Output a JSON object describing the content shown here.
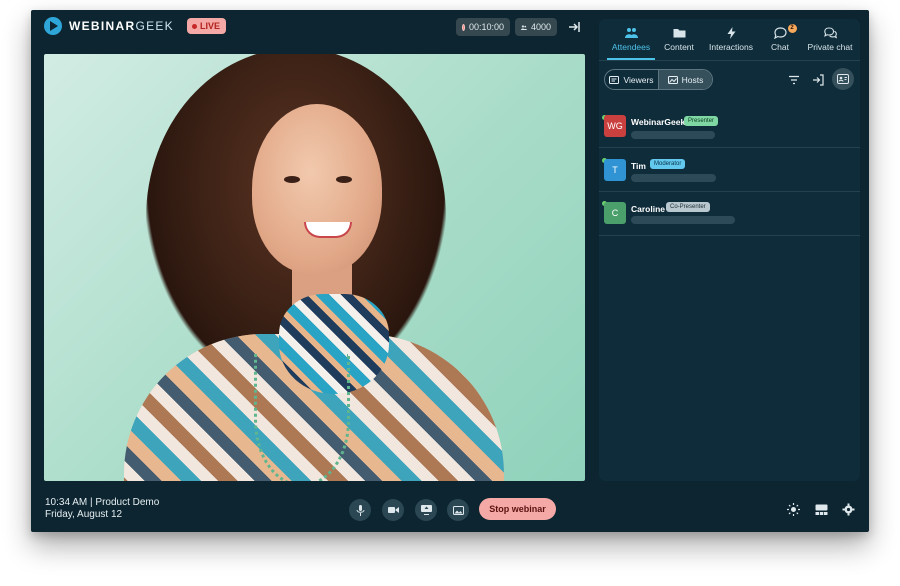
{
  "header": {
    "brand_bold": "WEBINAR",
    "brand_light": "GEEK",
    "live_label": "LIVE",
    "timer": "00:10:00",
    "viewer_count": "4000"
  },
  "footer": {
    "time_and_title": "10:34 AM | Product Demo",
    "date": "Friday, August 12",
    "stop_label": "Stop webinar"
  },
  "panel": {
    "tabs": [
      {
        "label": "Attendees",
        "icon": "attendees-icon",
        "active": true
      },
      {
        "label": "Content",
        "icon": "folder-icon"
      },
      {
        "label": "Interactions",
        "icon": "lightning-icon"
      },
      {
        "label": "Chat",
        "icon": "chat-icon",
        "badge": "2"
      },
      {
        "label": "Private chat",
        "icon": "private-chat-icon"
      }
    ],
    "segment": {
      "viewers_label": "Viewers",
      "hosts_label": "Hosts",
      "selected": "Hosts"
    },
    "hosts": [
      {
        "initials": "WG",
        "name": "WebinarGeek",
        "role": "Presenter",
        "avatar_color": "#c9403f",
        "role_bg": "#7fd8a3",
        "role_fg": "#0b3a22"
      },
      {
        "initials": "T",
        "name": "Tim",
        "role": "Moderator",
        "avatar_color": "#2f93d4",
        "role_bg": "#63c8ee",
        "role_fg": "#063347"
      },
      {
        "initials": "C",
        "name": "Caroline",
        "role": "Co-Presenter",
        "avatar_color": "#4a9f6a",
        "role_bg": "#b9c8cf",
        "role_fg": "#1c2b31"
      }
    ]
  },
  "colors": {
    "accent": "#4ec3ea",
    "app_bg": "#0c2530",
    "stop_button": "#f4a9a6",
    "live_badge": "#f4a9a6"
  }
}
